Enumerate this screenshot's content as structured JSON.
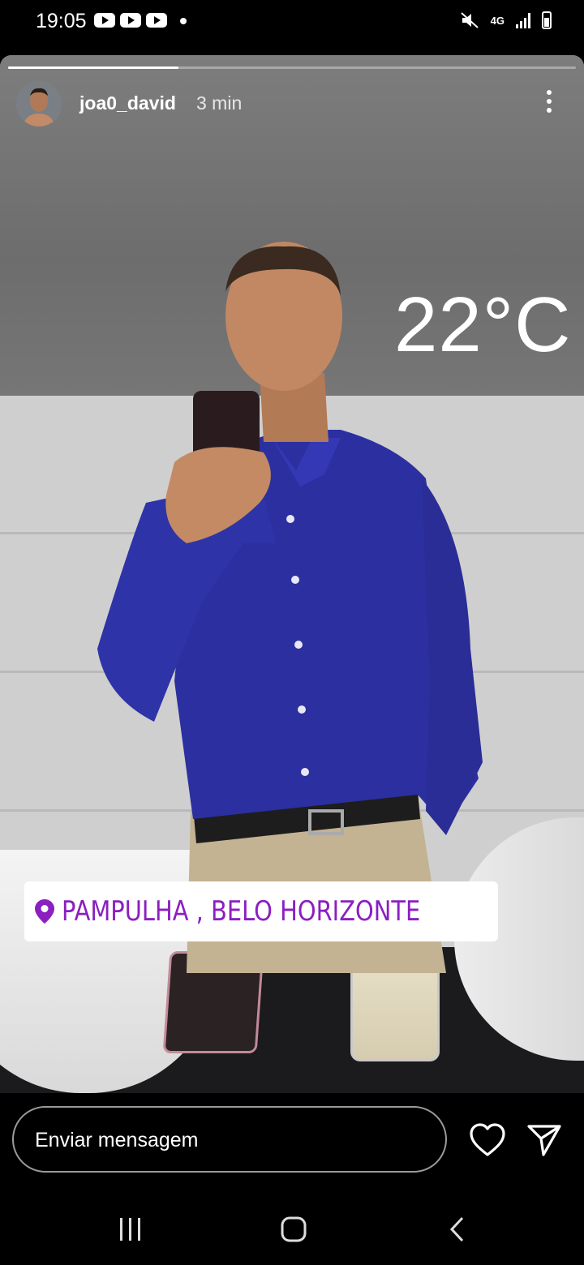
{
  "status_bar": {
    "time": "19:05",
    "network": "4G"
  },
  "story": {
    "progress": 0.3,
    "username": "joa0_david",
    "time_ago": "3 min",
    "temperature": "22°C",
    "location": "PAMPULHA , BELO HORIZONTE"
  },
  "reply_bar": {
    "placeholder": "Enviar mensagem"
  },
  "colors": {
    "location_text": "#8b1fc0",
    "shirt": "#2b2fa0"
  },
  "icons": {
    "more": "vertical-dots-icon",
    "like": "heart-icon",
    "share": "paper-plane-icon",
    "location": "map-pin-icon"
  }
}
